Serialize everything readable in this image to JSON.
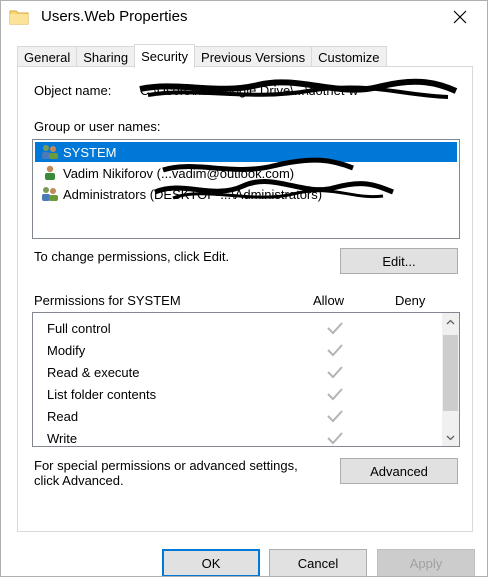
{
  "window": {
    "title": "Users.Web Properties",
    "close_glyph": "✕"
  },
  "tabs": [
    {
      "label": "General",
      "active": false
    },
    {
      "label": "Sharing",
      "active": false
    },
    {
      "label": "Security",
      "active": true
    },
    {
      "label": "Previous Versions",
      "active": false
    },
    {
      "label": "Customize",
      "active": false
    }
  ],
  "security": {
    "object_name_label": "Object name:",
    "object_name_value": "C:\\Users\\nik\\Google Drive\\...\\dotnet-w",
    "groups_label": "Group or user names:",
    "groups": [
      {
        "name": "SYSTEM",
        "selected": true,
        "icon": "users-group-icon"
      },
      {
        "name": "Vadim Nikiforov (...vadim@outlook.com)",
        "selected": false,
        "icon": "user-icon"
      },
      {
        "name": "Administrators (DESKTOP-...\\Administrators)",
        "selected": false,
        "icon": "users-group-icon"
      }
    ],
    "change_perms_text": "To change permissions, click Edit.",
    "edit_button": "Edit...",
    "perms_for_label": "Permissions for SYSTEM",
    "allow_header": "Allow",
    "deny_header": "Deny",
    "permissions": [
      {
        "name": "Full control",
        "allow": true,
        "deny": false
      },
      {
        "name": "Modify",
        "allow": true,
        "deny": false
      },
      {
        "name": "Read & execute",
        "allow": true,
        "deny": false
      },
      {
        "name": "List folder contents",
        "allow": true,
        "deny": false
      },
      {
        "name": "Read",
        "allow": true,
        "deny": false
      },
      {
        "name": "Write",
        "allow": true,
        "deny": false
      }
    ],
    "special_text_line1": "For special permissions or advanced settings,",
    "special_text_line2": "click Advanced.",
    "advanced_button": "Advanced"
  },
  "footer": {
    "ok": "OK",
    "cancel": "Cancel",
    "apply": "Apply"
  },
  "colors": {
    "selection": "#0078d7",
    "check": "#b4b4b4"
  }
}
